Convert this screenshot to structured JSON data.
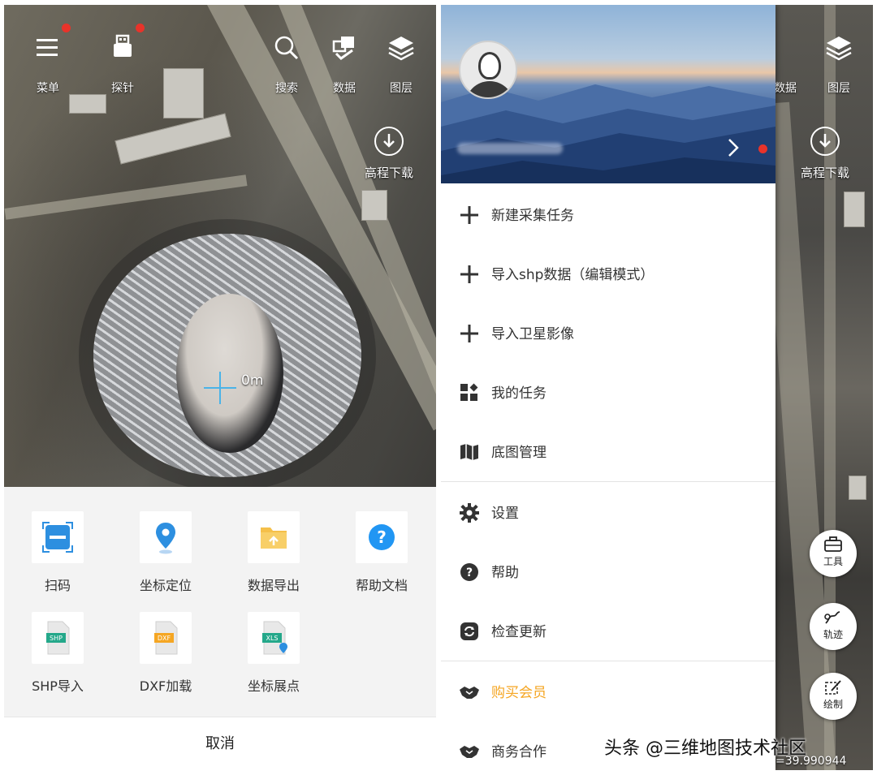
{
  "left": {
    "top_bar": {
      "menu_label": "菜单",
      "probe_label": "探针",
      "search_label": "搜索",
      "data_label": "数据",
      "layers_label": "图层"
    },
    "elevation_download_label": "高程下载",
    "scale_label": "0m",
    "sheet": {
      "items": [
        {
          "label": "扫码",
          "icon": "scan-icon"
        },
        {
          "label": "坐标定位",
          "icon": "location-pin-icon"
        },
        {
          "label": "数据导出",
          "icon": "folder-export-icon"
        },
        {
          "label": "帮助文档",
          "icon": "help-icon"
        },
        {
          "label": "SHP导入",
          "icon": "shp-file-icon",
          "badge": "SHP"
        },
        {
          "label": "DXF加载",
          "icon": "dxf-file-icon",
          "badge": "DXF"
        },
        {
          "label": "坐标展点",
          "icon": "xls-file-icon",
          "badge": "XLS"
        }
      ],
      "cancel_label": "取消"
    }
  },
  "right": {
    "top_bar": {
      "data_label": "数据",
      "layers_label": "图层"
    },
    "elevation_download_label": "高程下载",
    "drawer": {
      "items": [
        {
          "label": "新建采集任务",
          "icon": "plus-icon"
        },
        {
          "label": "导入shp数据（编辑模式）",
          "icon": "plus-icon"
        },
        {
          "label": "导入卫星影像",
          "icon": "plus-icon"
        },
        {
          "label": "我的任务",
          "icon": "tasks-icon"
        },
        {
          "label": "底图管理",
          "icon": "map-icon"
        },
        {
          "label": "设置",
          "icon": "gear-icon"
        },
        {
          "label": "帮助",
          "icon": "help-icon"
        },
        {
          "label": "检查更新",
          "icon": "refresh-icon"
        },
        {
          "label": "购买会员",
          "icon": "handshake-icon"
        },
        {
          "label": "商务合作",
          "icon": "handshake-icon"
        }
      ]
    },
    "fabs": {
      "tools_label": "工具",
      "track_label": "轨迹",
      "draw_label": "绘制"
    },
    "coord_text": "=39.990944"
  },
  "watermark_text": "头条 @三维地图技术社区",
  "colors": {
    "accent_blue": "#4ab3e8",
    "notify_red": "#e8332a",
    "member_orange": "#f5a623"
  }
}
